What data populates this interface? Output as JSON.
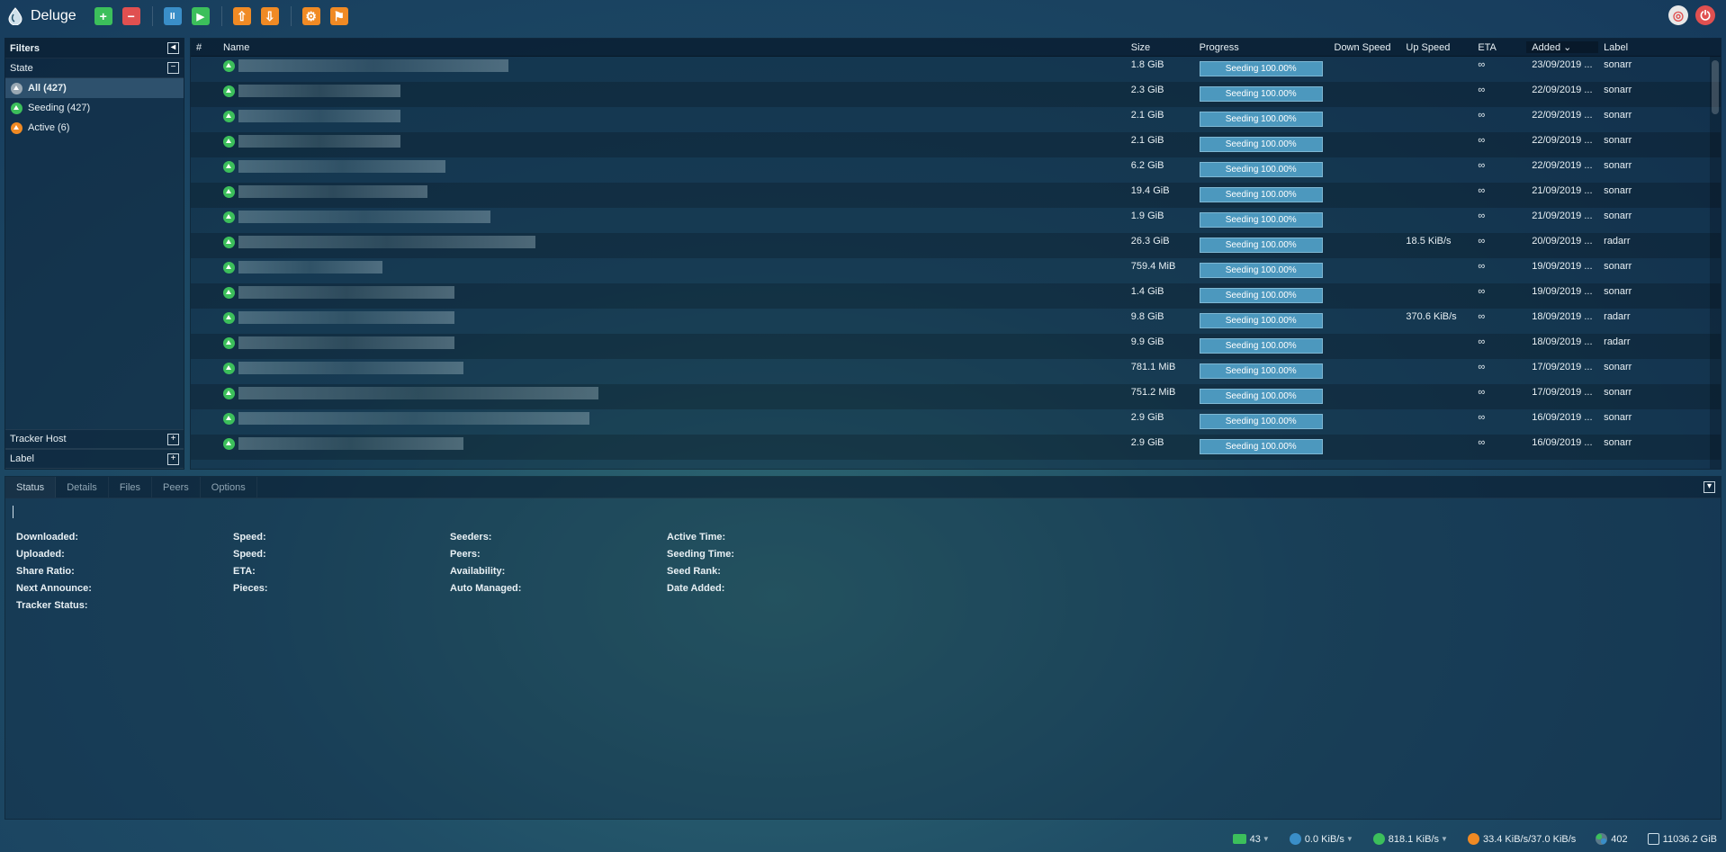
{
  "app": {
    "title": "Deluge"
  },
  "toolbar": {
    "add": "+",
    "remove": "−",
    "pause": "II",
    "resume": "▶",
    "up": "⇧",
    "down": "⇩",
    "prefs": "⚙",
    "plugins": "⚑",
    "help": "◎",
    "logout": "⏻"
  },
  "filters": {
    "title": "Filters",
    "state_label": "State",
    "items": [
      {
        "label": "All (427)"
      },
      {
        "label": "Seeding (427)"
      },
      {
        "label": "Active (6)"
      }
    ],
    "tracker_host": "Tracker Host",
    "label": "Label"
  },
  "grid": {
    "columns": {
      "num": "#",
      "name": "Name",
      "size": "Size",
      "progress": "Progress",
      "down_speed": "Down Speed",
      "up_speed": "Up Speed",
      "eta": "ETA",
      "added": "Added",
      "label": "Label"
    },
    "rows": [
      {
        "blur": 0.3,
        "size": "1.8 GiB",
        "progress": "Seeding 100.00%",
        "up": "",
        "eta": "∞",
        "added": "23/09/2019 ...",
        "label": "sonarr"
      },
      {
        "blur": 0.18,
        "size": "2.3 GiB",
        "progress": "Seeding 100.00%",
        "up": "",
        "eta": "∞",
        "added": "22/09/2019 ...",
        "label": "sonarr"
      },
      {
        "blur": 0.18,
        "size": "2.1 GiB",
        "progress": "Seeding 100.00%",
        "up": "",
        "eta": "∞",
        "added": "22/09/2019 ...",
        "label": "sonarr"
      },
      {
        "blur": 0.18,
        "size": "2.1 GiB",
        "progress": "Seeding 100.00%",
        "up": "",
        "eta": "∞",
        "added": "22/09/2019 ...",
        "label": "sonarr"
      },
      {
        "blur": 0.23,
        "size": "6.2 GiB",
        "progress": "Seeding 100.00%",
        "up": "",
        "eta": "∞",
        "added": "22/09/2019 ...",
        "label": "sonarr"
      },
      {
        "blur": 0.21,
        "size": "19.4 GiB",
        "progress": "Seeding 100.00%",
        "up": "",
        "eta": "∞",
        "added": "21/09/2019 ...",
        "label": "sonarr"
      },
      {
        "blur": 0.28,
        "size": "1.9 GiB",
        "progress": "Seeding 100.00%",
        "up": "",
        "eta": "∞",
        "added": "21/09/2019 ...",
        "label": "sonarr"
      },
      {
        "blur": 0.33,
        "size": "26.3 GiB",
        "progress": "Seeding 100.00%",
        "up": "18.5 KiB/s",
        "eta": "∞",
        "added": "20/09/2019 ...",
        "label": "radarr"
      },
      {
        "blur": 0.16,
        "size": "759.4 MiB",
        "progress": "Seeding 100.00%",
        "up": "",
        "eta": "∞",
        "added": "19/09/2019 ...",
        "label": "sonarr"
      },
      {
        "blur": 0.24,
        "size": "1.4 GiB",
        "progress": "Seeding 100.00%",
        "up": "",
        "eta": "∞",
        "added": "19/09/2019 ...",
        "label": "sonarr"
      },
      {
        "blur": 0.24,
        "size": "9.8 GiB",
        "progress": "Seeding 100.00%",
        "up": "370.6 KiB/s",
        "eta": "∞",
        "added": "18/09/2019 ...",
        "label": "radarr"
      },
      {
        "blur": 0.24,
        "size": "9.9 GiB",
        "progress": "Seeding 100.00%",
        "up": "",
        "eta": "∞",
        "added": "18/09/2019 ...",
        "label": "radarr"
      },
      {
        "blur": 0.25,
        "size": "781.1 MiB",
        "progress": "Seeding 100.00%",
        "up": "",
        "eta": "∞",
        "added": "17/09/2019 ...",
        "label": "sonarr"
      },
      {
        "blur": 0.4,
        "size": "751.2 MiB",
        "progress": "Seeding 100.00%",
        "up": "",
        "eta": "∞",
        "added": "17/09/2019 ...",
        "label": "sonarr"
      },
      {
        "blur": 0.39,
        "size": "2.9 GiB",
        "progress": "Seeding 100.00%",
        "up": "",
        "eta": "∞",
        "added": "16/09/2019 ...",
        "label": "sonarr"
      },
      {
        "blur": 0.25,
        "size": "2.9 GiB",
        "progress": "Seeding 100.00%",
        "up": "",
        "eta": "∞",
        "added": "16/09/2019 ...",
        "label": "sonarr"
      }
    ]
  },
  "detail": {
    "tabs": [
      "Status",
      "Details",
      "Files",
      "Peers",
      "Options"
    ],
    "fields": [
      "Downloaded:",
      "Speed:",
      "Seeders:",
      "Active Time:",
      "Uploaded:",
      "Speed:",
      "Peers:",
      "Seeding Time:",
      "Share Ratio:",
      "ETA:",
      "Availability:",
      "Seed Rank:",
      "Next Announce:",
      "Pieces:",
      "Auto Managed:",
      "Date Added:",
      "Tracker Status:"
    ]
  },
  "statusbar": {
    "connections": "43",
    "down_speed": "0.0 KiB/s",
    "up_speed": "818.1 KiB/s",
    "protocol": "33.4 KiB/s/37.0 KiB/s",
    "dht": "402",
    "free_space": "11036.2 GiB"
  },
  "colors": {
    "green": "#3cbf5b",
    "red": "#e05050",
    "blue": "#3a8ec8",
    "orange": "#f08a24",
    "progress": "#4c98be"
  }
}
